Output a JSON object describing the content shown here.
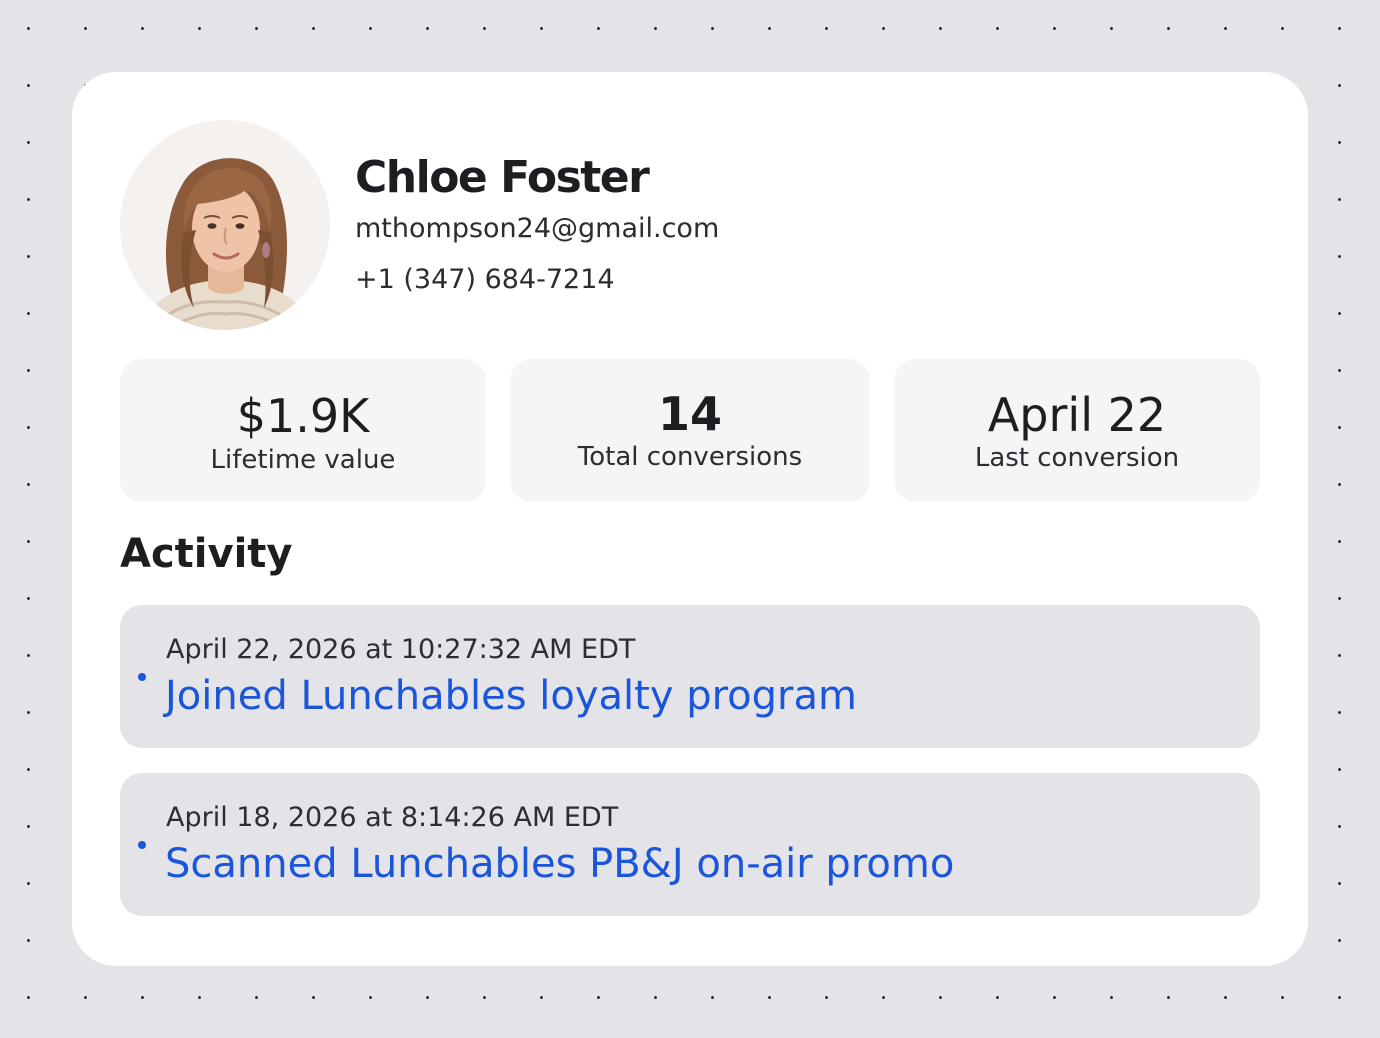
{
  "profile": {
    "avatar_alt": "Chloe Foster profile photo",
    "name": "Chloe Foster",
    "email": "mthompson24@gmail.com",
    "phone": "+1 (347) 684-7214"
  },
  "stats": [
    {
      "value": "$1.9K",
      "label": "Lifetime value"
    },
    {
      "value": "14",
      "label": "Total conversions"
    },
    {
      "value": "April 22",
      "label": "Last conversion"
    }
  ],
  "activity": {
    "heading": "Activity",
    "items": [
      {
        "timestamp": "April 22, 2026 at 10:27:32 AM EDT",
        "title": "Joined Lunchables loyalty program"
      },
      {
        "timestamp": "April 18, 2026 at 8:14:26 AM EDT",
        "title": "Scanned Lunchables PB&J on-air promo"
      }
    ]
  },
  "colors": {
    "background": "#e4e3e8",
    "card": "#ffffff",
    "stat_tile": "#f5f4f7",
    "activity_tile": "#e4e3e8",
    "link": "#1a56db",
    "text": "#1e1e22"
  }
}
